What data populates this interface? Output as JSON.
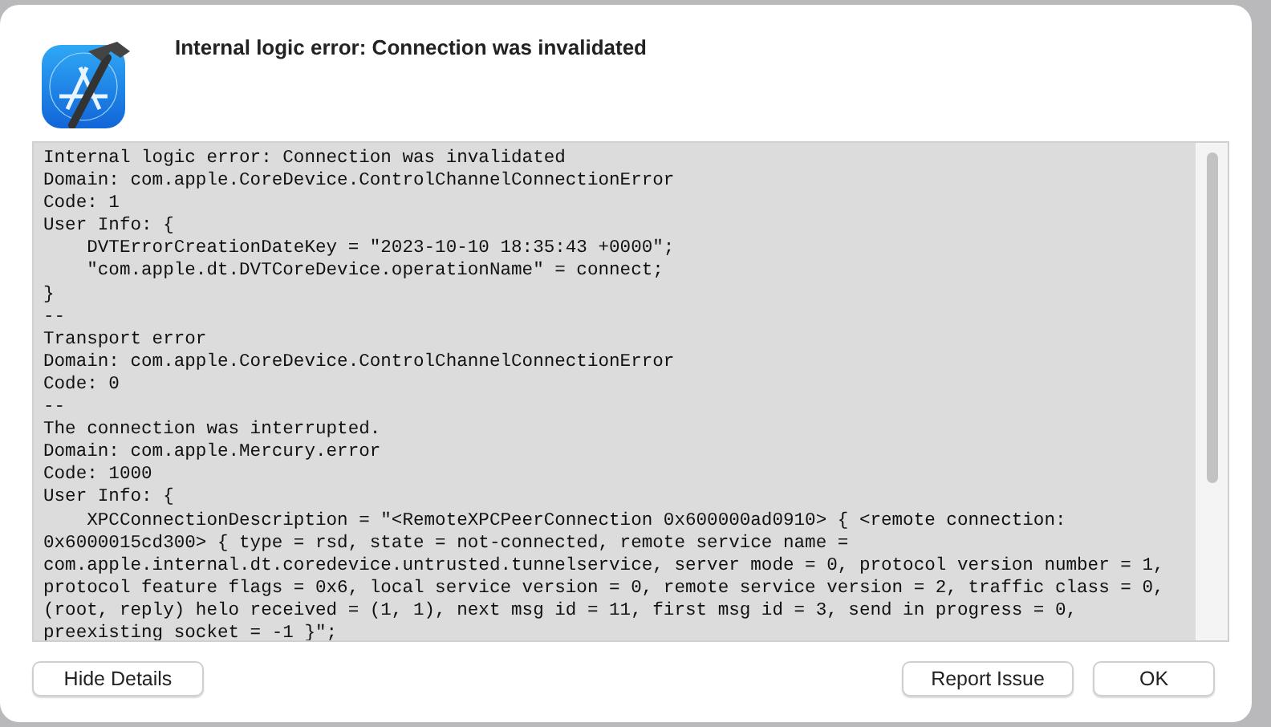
{
  "dialog": {
    "title": "Internal logic error: Connection was invalidated"
  },
  "details": {
    "lines": [
      "Internal logic error: Connection was invalidated",
      "Domain: com.apple.CoreDevice.ControlChannelConnectionError",
      "Code: 1",
      "User Info: {",
      "    DVTErrorCreationDateKey = \"2023-10-10 18:35:43 +0000\";",
      "    \"com.apple.dt.DVTCoreDevice.operationName\" = connect;",
      "}",
      "--",
      "Transport error",
      "Domain: com.apple.CoreDevice.ControlChannelConnectionError",
      "Code: 0",
      "--",
      "The connection was interrupted.",
      "Domain: com.apple.Mercury.error",
      "Code: 1000",
      "User Info: {",
      "    XPCConnectionDescription = \"<RemoteXPCPeerConnection 0x600000ad0910> { <remote connection:",
      "0x6000015cd300> { type = rsd, state = not-connected, remote service name =",
      "com.apple.internal.dt.coredevice.untrusted.tunnelservice, server mode = 0, protocol version number = 1,",
      "protocol feature flags = 0x6, local service version = 0, remote service version = 2, traffic class = 0,",
      "(root, reply) helo received = (1, 1), next msg id = 11, first msg id = 3, send in progress = 0,",
      "preexisting socket = -1 }\";"
    ]
  },
  "left_buttons": [
    "Hide Details"
  ],
  "right_buttons": [
    "Report Issue",
    "OK"
  ]
}
